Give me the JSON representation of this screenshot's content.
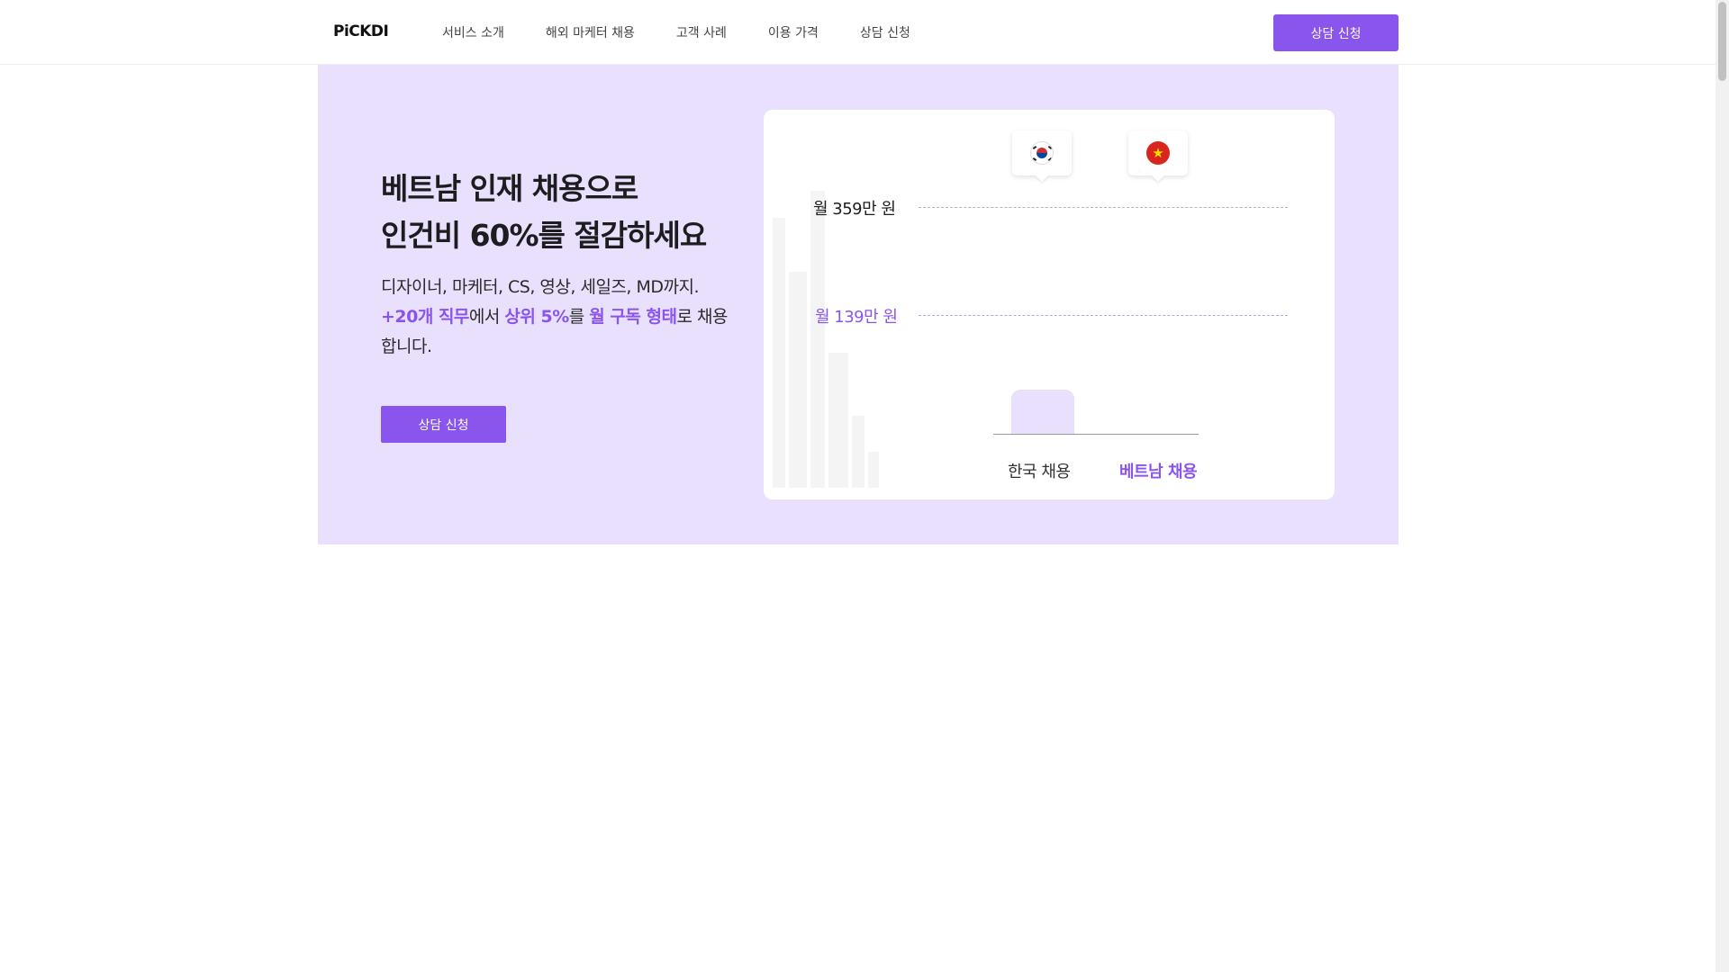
{
  "header": {
    "logo": "PiCKDI",
    "nav": [
      {
        "label": "서비스 소개"
      },
      {
        "label": "해외 마케터 채용"
      },
      {
        "label": "고객 사례"
      },
      {
        "label": "이용 가격"
      },
      {
        "label": "상담 신청"
      }
    ],
    "cta_label": "상담 신청"
  },
  "hero": {
    "title_line1": "베트남 인재 채용으로",
    "title_line2": "인건비 60%를 절감하세요",
    "desc_line1": "디자이너, 마케터, CS, 영상, 세일즈, MD까지.",
    "desc_hl1": "+20개 직무",
    "desc_t1": "에서 ",
    "desc_hl2": "상위 5%",
    "desc_t2": "를 ",
    "desc_hl3": "월 구독 형태",
    "desc_t3": "로 채용합니다.",
    "cta_label": "상담 신청"
  },
  "comparison": {
    "korea": {
      "line_label": "월 359만 원",
      "category": "한국 채용",
      "flag": "south-korea-flag-icon"
    },
    "vietnam": {
      "line_label": "월 139만 원",
      "category": "베트남 채용",
      "flag": "vietnam-flag-icon"
    }
  },
  "colors": {
    "accent": "#8a55ec",
    "hero_bg": "#e9e0fd"
  }
}
